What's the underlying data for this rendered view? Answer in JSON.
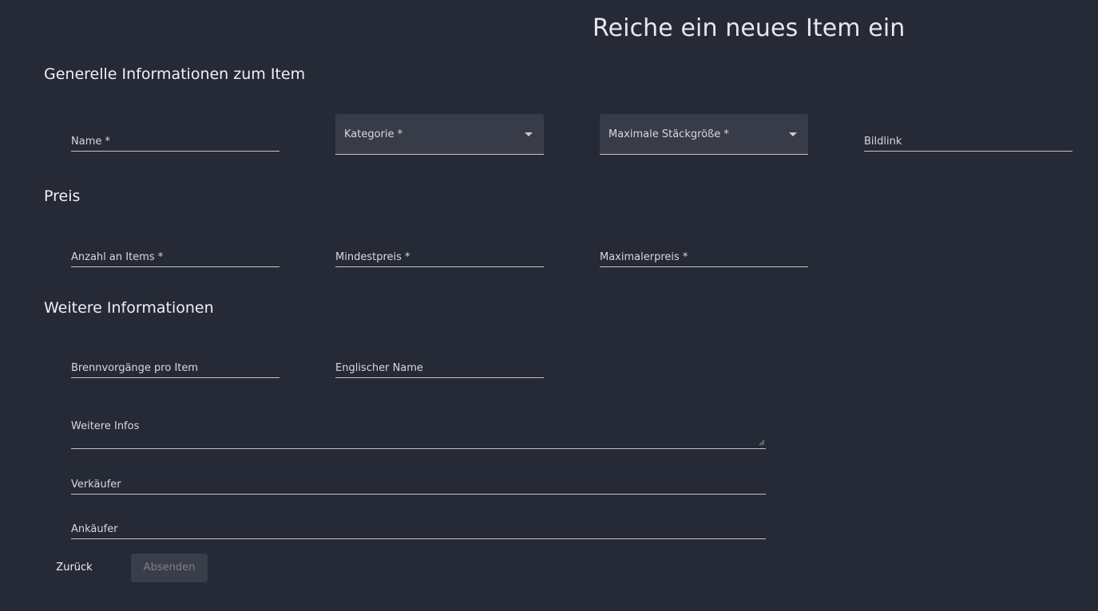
{
  "page": {
    "title": "Reiche ein neues Item ein"
  },
  "sections": {
    "general": "Generelle Informationen zum Item",
    "price": "Preis",
    "more": "Weitere Informationen"
  },
  "fields": {
    "name": "Name *",
    "category": "Kategorie *",
    "max_stack": "Maximale Stäckgröße *",
    "image_link": "Bildlink",
    "item_count": "Anzahl an Items *",
    "min_price": "Mindestpreis *",
    "max_price": "Maximalerpreis *",
    "burns_per_item": "Brennvorgänge pro Item",
    "english_name": "Englischer Name",
    "more_info": "Weitere Infos",
    "seller": "Verkäufer",
    "buyer": "Ankäufer"
  },
  "actions": {
    "back": "Zurück",
    "submit": "Absenden"
  },
  "colors": {
    "background": "#262a36",
    "select_fill": "#383c48",
    "disabled_button": "#3a3e4a"
  }
}
